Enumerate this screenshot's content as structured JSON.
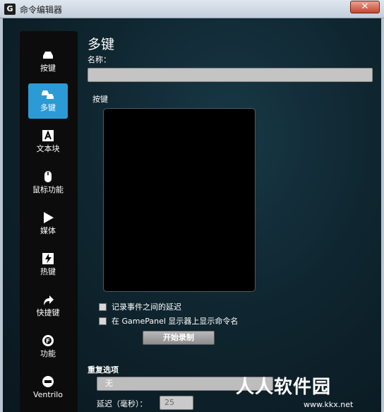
{
  "window": {
    "title": "命令编辑器",
    "logo": "G",
    "close": "✕"
  },
  "nav": {
    "items": [
      {
        "label": "按键",
        "icon": "keyboard-key-icon"
      },
      {
        "label": "多键",
        "icon": "multi-key-icon",
        "active": true
      },
      {
        "label": "文本块",
        "icon": "text-block-icon"
      },
      {
        "label": "鼠标功能",
        "icon": "mouse-icon"
      },
      {
        "label": "媒体",
        "icon": "play-icon"
      },
      {
        "label": "热键",
        "icon": "hotkey-icon"
      },
      {
        "label": "快捷键",
        "icon": "shortcut-arrow-icon"
      },
      {
        "label": "功能",
        "icon": "function-gear-icon"
      },
      {
        "label": "Ventrilo",
        "icon": "headset-icon"
      }
    ]
  },
  "panel": {
    "title": "多键",
    "name_label": "名称：",
    "name_value": "",
    "keys_label": "按键",
    "options": [
      {
        "label": "记录事件之间的延迟",
        "checked": false
      },
      {
        "label": "在 GamePanel 显示器上显示命令名",
        "checked": false
      }
    ],
    "record_button": "开始录制",
    "repeat_label": "重复选项",
    "repeat_value": "无",
    "delay_label": "延迟（毫秒）：",
    "delay_value": "25"
  },
  "watermark": {
    "brand": "人人软件园",
    "url": "www.kkx.net"
  },
  "colors": {
    "accent": "#2c9ad4",
    "background": "#0f2630"
  }
}
